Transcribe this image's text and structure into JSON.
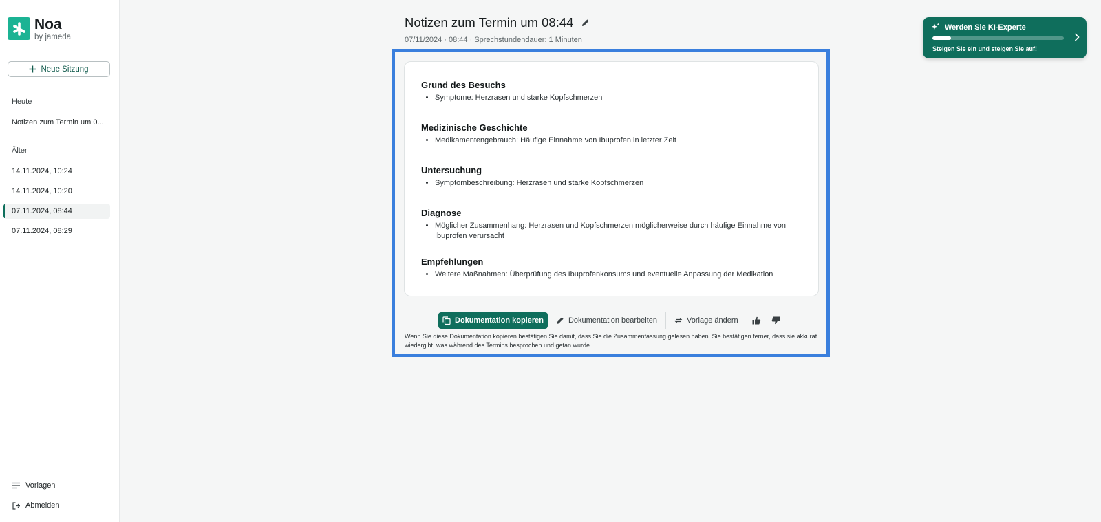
{
  "app": {
    "name": "Noa",
    "byline": "by jameda"
  },
  "sidebar": {
    "new_session_label": "Neue Sitzung",
    "today_label": "Heute",
    "today_items": [
      "Notizen zum Termin um 0..."
    ],
    "older_label": "Älter",
    "older_items": [
      "14.11.2024, 10:24",
      "14.11.2024, 10:20",
      "07.11.2024, 08:44",
      "07.11.2024, 08:29"
    ],
    "active_item": "07.11.2024, 08:44",
    "bottom": {
      "templates_label": "Vorlagen",
      "logout_label": "Abmelden"
    }
  },
  "header": {
    "title": "Notizen zum Termin um 08:44",
    "meta": "07/11/2024 · 08:44 · Sprechstundendauer: 1 Minuten"
  },
  "note": {
    "sections": [
      {
        "heading": "Grund des Besuchs",
        "items": [
          "Symptome: Herzrasen und starke Kopfschmerzen"
        ]
      },
      {
        "heading": "Medizinische Geschichte",
        "items": [
          "Medikamentengebrauch: Häufige Einnahme von Ibuprofen in letzter Zeit"
        ]
      },
      {
        "heading": "Untersuchung",
        "items": [
          "Symptombeschreibung: Herzrasen und starke Kopfschmerzen"
        ]
      },
      {
        "heading": "Diagnose",
        "items": [
          "Möglicher Zusammenhang: Herzrasen und Kopfschmerzen möglicherweise durch häufige Einnahme von Ibuprofen verursacht"
        ]
      },
      {
        "heading": "Empfehlungen",
        "items": [
          "Weitere Maßnahmen: Überprüfung des Ibuprofenkonsums und eventuelle Anpassung der Medikation"
        ]
      }
    ]
  },
  "actions": {
    "copy_label": "Dokumentation kopieren",
    "edit_label": "Dokumentation bearbeiten",
    "template_label": "Vorlage ändern",
    "icons": [
      "copy-icon",
      "pencil-icon",
      "swap-icon",
      "thumbs-up-icon",
      "thumbs-down-icon"
    ]
  },
  "disclaimer": "Wenn Sie diese Dokumentation kopieren bestätigen Sie damit, dass Sie die Zusammenfassung gelesen haben. Sie bestätigen ferner, dass sie akkurat wiedergibt, was während des Termins besprochen und getan wurde.",
  "promo": {
    "title": "Werden Sie KI-Experte",
    "subtitle": "Steigen Sie ein und steigen Sie auf!",
    "progress": 0.14
  },
  "colors": {
    "brand_green": "#0f6e5c",
    "logo_green": "#1bb394",
    "highlight_blue": "#3a7fdd"
  }
}
